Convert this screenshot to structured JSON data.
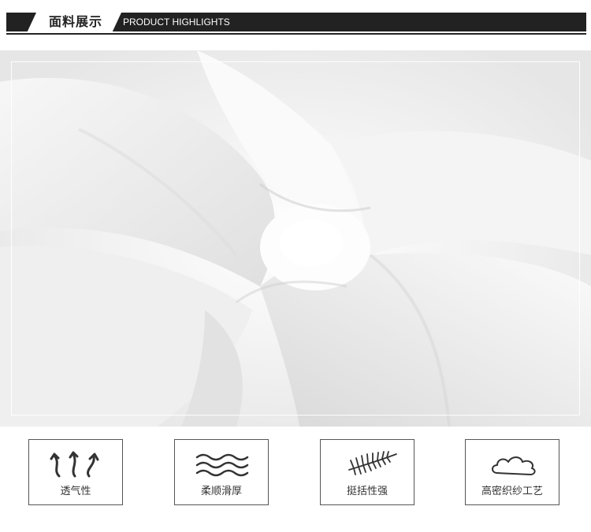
{
  "header": {
    "title_cn": "面料展示",
    "title_en": "PRODUCT HIGHLIGHTS"
  },
  "photo": {
    "subject": "fabric-photo"
  },
  "features": [
    {
      "label": "透气性",
      "icon": "breathable-arrows-icon"
    },
    {
      "label": "柔顺滑厚",
      "icon": "waves-icon"
    },
    {
      "label": "挺括性强",
      "icon": "feather-icon"
    },
    {
      "label": "高密织纱工艺",
      "icon": "cloud-icon"
    }
  ],
  "colors": {
    "header_bar": "#222222",
    "border": "#555555",
    "text": "#333333"
  }
}
